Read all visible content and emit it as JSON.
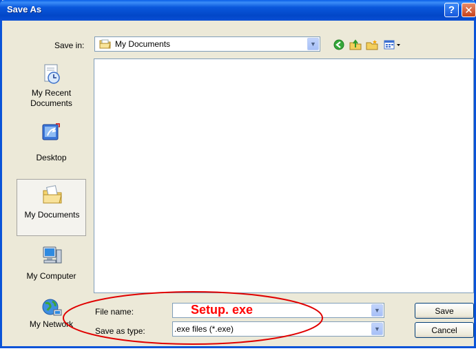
{
  "window": {
    "title": "Save As"
  },
  "titlebar_buttons": {
    "help": "?",
    "close": "✕"
  },
  "save_in": {
    "label": "Save in:",
    "value": "My Documents"
  },
  "toolbar": {
    "icons": [
      "back-icon",
      "up-folder-icon",
      "new-folder-icon",
      "views-menu-icon"
    ]
  },
  "places": [
    {
      "label": "My Recent Documents",
      "icon": "recent-documents-icon"
    },
    {
      "label": "Desktop",
      "icon": "desktop-icon"
    },
    {
      "label": "My Documents",
      "icon": "my-documents-icon",
      "selected": true
    },
    {
      "label": "My Computer",
      "icon": "my-computer-icon"
    },
    {
      "label": "My Network",
      "icon": "my-network-icon"
    }
  ],
  "file_name": {
    "label": "File name:",
    "value": "Setup. exe"
  },
  "save_as_type": {
    "label": "Save as type:",
    "value": ".exe files (*.exe)"
  },
  "buttons": {
    "save": "Save",
    "cancel": "Cancel"
  },
  "colors": {
    "title_blue": "#0a58dc",
    "annotation": "#e00000",
    "face": "#ece9d8"
  }
}
